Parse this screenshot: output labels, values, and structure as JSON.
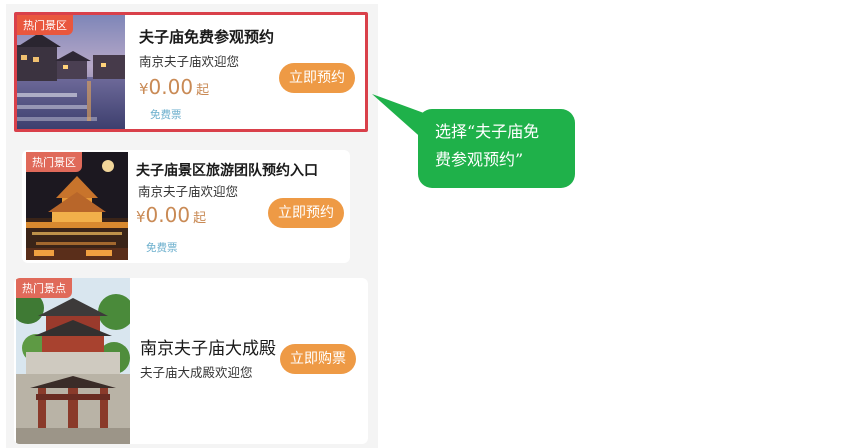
{
  "cards": [
    {
      "tag": "热门景区",
      "title": "夫子庙免费参观预约",
      "subtitle": "南京夫子庙欢迎您",
      "price_symbol": "¥",
      "price": "0.00",
      "price_suffix": "起",
      "free_label": "免费票",
      "button": "立即预约",
      "selected": true
    },
    {
      "tag": "热门景区",
      "title": "夫子庙景区旅游团队预约入口",
      "subtitle": "南京夫子庙欢迎您",
      "price_symbol": "¥",
      "price": "0.00",
      "price_suffix": "起",
      "free_label": "免费票",
      "button": "立即预约",
      "selected": false
    },
    {
      "tag": "热门景点",
      "title": "南京夫子庙大成殿",
      "subtitle": "夫子庙大成殿欢迎您",
      "button": "立即购票",
      "selected": false
    }
  ],
  "callout": {
    "line1": "选择“夫子庙免",
    "line2": "费参观预约”"
  },
  "colors": {
    "highlight_border": "#d9404a",
    "tag_bg": "#e9573e",
    "button_bg": "#ee9a45",
    "price_text": "#c98a55",
    "callout_bg": "#1fb14a"
  }
}
